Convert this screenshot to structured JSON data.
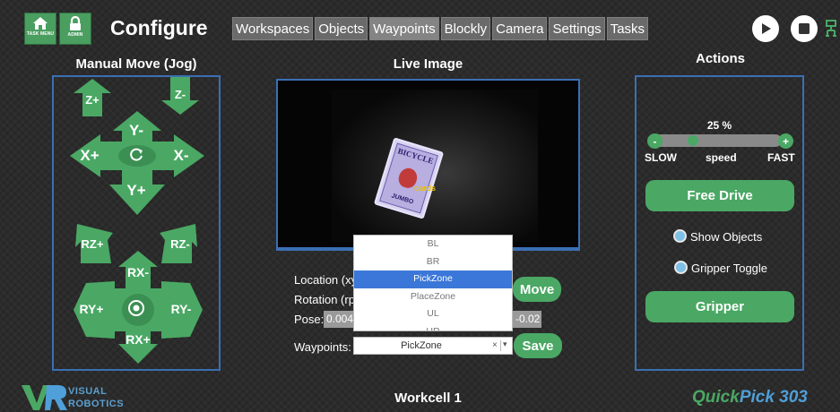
{
  "header": {
    "task_menu_label": "TASK MENU",
    "admin_label": "ADMIN",
    "title": "Configure",
    "tabs": [
      {
        "label": "Workspaces",
        "active": false
      },
      {
        "label": "Objects",
        "active": false
      },
      {
        "label": "Waypoints",
        "active": true
      },
      {
        "label": "Blockly",
        "active": false
      },
      {
        "label": "Camera",
        "active": false
      },
      {
        "label": "Settings",
        "active": false
      },
      {
        "label": "Tasks",
        "active": false
      }
    ],
    "play_icon": "play-icon",
    "stop_icon": "stop-icon",
    "network_icon": "network-status-icon"
  },
  "jog": {
    "title": "Manual Move (Jog)",
    "z_plus": "Z+",
    "z_minus": "Z-",
    "y_minus": "Y-",
    "y_plus": "Y+",
    "x_plus": "X+",
    "x_minus": "X-",
    "rz_plus": "RZ+",
    "rz_minus": "RZ-",
    "rx_minus": "RX-",
    "rx_plus": "RX+",
    "ry_plus": "RY+",
    "ry_minus": "RY-"
  },
  "live": {
    "title": "Live Image",
    "detected_label": "cards",
    "card_top_text": "BICYCLE",
    "card_bottom_text": "JUMBO"
  },
  "waypoint_form": {
    "location_label": "Location (xy",
    "rotation_label": "Rotation (rp",
    "pose_label": "Pose:",
    "pose_value_left": "0.004",
    "pose_value_right": "-0.02",
    "move_label": "Move",
    "waypoints_label": "Waypoints:",
    "selected_waypoint": "PickZone",
    "save_label": "Save",
    "dropdown_options": [
      "BL",
      "BR",
      "PickZone",
      "PlaceZone",
      "UL",
      "UR"
    ],
    "selected_index": 2
  },
  "actions": {
    "title": "Actions",
    "speed_value": "25 %",
    "speed_fraction": 0.25,
    "slow_label": "SLOW",
    "speed_label": "speed",
    "fast_label": "FAST",
    "minus_label": "-",
    "plus_label": "+",
    "free_drive_label": "Free Drive",
    "show_objects_label": "Show Objects",
    "gripper_toggle_label": "Gripper Toggle",
    "gripper_label": "Gripper"
  },
  "footer": {
    "logo_line1": "VISUAL",
    "logo_line2": "ROBOTICS",
    "workcell": "Workcell 1",
    "brand_part1": "Quick",
    "brand_part2": "Pick 303"
  },
  "colors": {
    "accent_green": "#4aa864",
    "panel_border": "#3b6fb4",
    "brand_green": "#4aa864",
    "brand_blue": "#4f9fd8",
    "selection_blue": "#3b77d8"
  }
}
